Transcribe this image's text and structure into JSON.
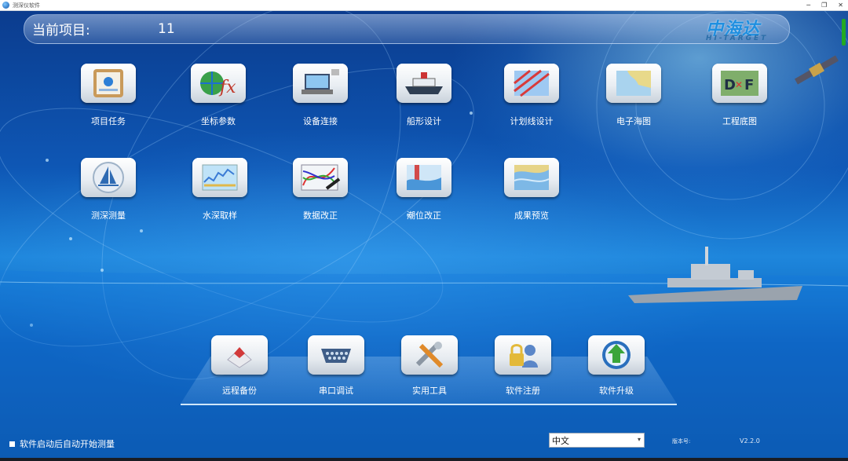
{
  "window": {
    "title": "测深仪软件"
  },
  "header": {
    "project_label": "当前项目:",
    "project_value": "11"
  },
  "logo": {
    "cn": "中海达",
    "en": "HI-TARGET"
  },
  "main_tiles": [
    {
      "label": "项目任务",
      "icon": "project-task-icon"
    },
    {
      "label": "坐标参数",
      "icon": "coordinate-fx-icon"
    },
    {
      "label": "设备连接",
      "icon": "device-connect-icon"
    },
    {
      "label": "船形设计",
      "icon": "ship-icon"
    },
    {
      "label": "计划线设计",
      "icon": "plan-line-icon"
    },
    {
      "label": "电子海图",
      "icon": "chart-map-icon"
    },
    {
      "label": "工程底图",
      "icon": "dxf-icon"
    },
    {
      "label": "测深测量",
      "icon": "sailboat-icon"
    },
    {
      "label": "水深取样",
      "icon": "depth-sample-icon"
    },
    {
      "label": "数据改正",
      "icon": "data-correct-icon"
    },
    {
      "label": "潮位改正",
      "icon": "tide-icon"
    },
    {
      "label": "成果预览",
      "icon": "result-preview-icon"
    }
  ],
  "dock_tiles": [
    {
      "label": "远程备份",
      "icon": "remote-backup-icon"
    },
    {
      "label": "串口调试",
      "icon": "serial-port-icon"
    },
    {
      "label": "实用工具",
      "icon": "tools-icon"
    },
    {
      "label": "软件注册",
      "icon": "register-lock-icon"
    },
    {
      "label": "软件升级",
      "icon": "upgrade-arrow-icon"
    }
  ],
  "footer": {
    "autostart_label": "软件启动后自动开始测量",
    "language_selected": "中文",
    "version_label": "版本号:",
    "version_value": "V2.2.0"
  }
}
